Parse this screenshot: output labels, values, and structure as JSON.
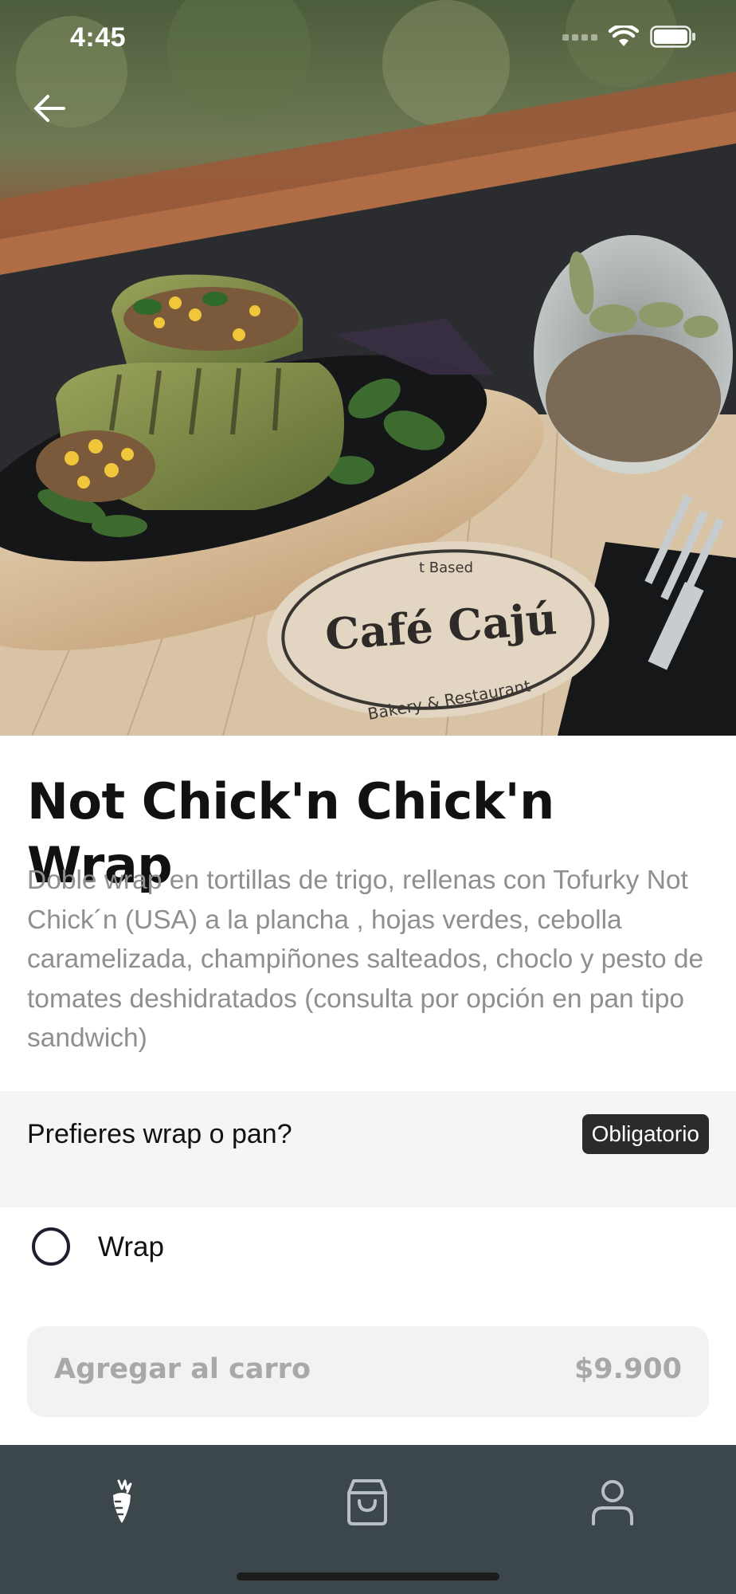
{
  "status_bar": {
    "time": "4:45"
  },
  "hero": {
    "coaster_brand": "Café Cajú",
    "coaster_subtitle": "Bakery & Restaurant",
    "coaster_top": "t Based"
  },
  "product": {
    "title": "Not Chick'n Chick'n Wrap",
    "description": "Doble wrap en tortillas de trigo, rellenas con Tofurky Not Chick´n (USA) a la plancha , hojas verdes, cebolla caramelizada, champiñones salteados, choclo y pesto de tomates deshidratados (consulta por opción en pan tipo sandwich)"
  },
  "option_group": {
    "question": "Prefieres wrap o pan?",
    "required_badge": "Obligatorio",
    "options": [
      {
        "label": "Wrap",
        "selected": false
      }
    ]
  },
  "cart_button": {
    "label": "Agregar al carro",
    "price": "$9.900"
  },
  "bottom_nav": {
    "tabs": [
      {
        "icon": "carrot-icon",
        "active": true
      },
      {
        "icon": "shopping-bag-icon",
        "active": false
      },
      {
        "icon": "user-icon",
        "active": false
      }
    ]
  },
  "colors": {
    "nav_background": "#3c474b",
    "option_header_background": "#f5f5f5",
    "badge_background": "#2b2b2b",
    "description_text": "#8f8f8f",
    "cart_button_background": "#f2f2f2"
  }
}
